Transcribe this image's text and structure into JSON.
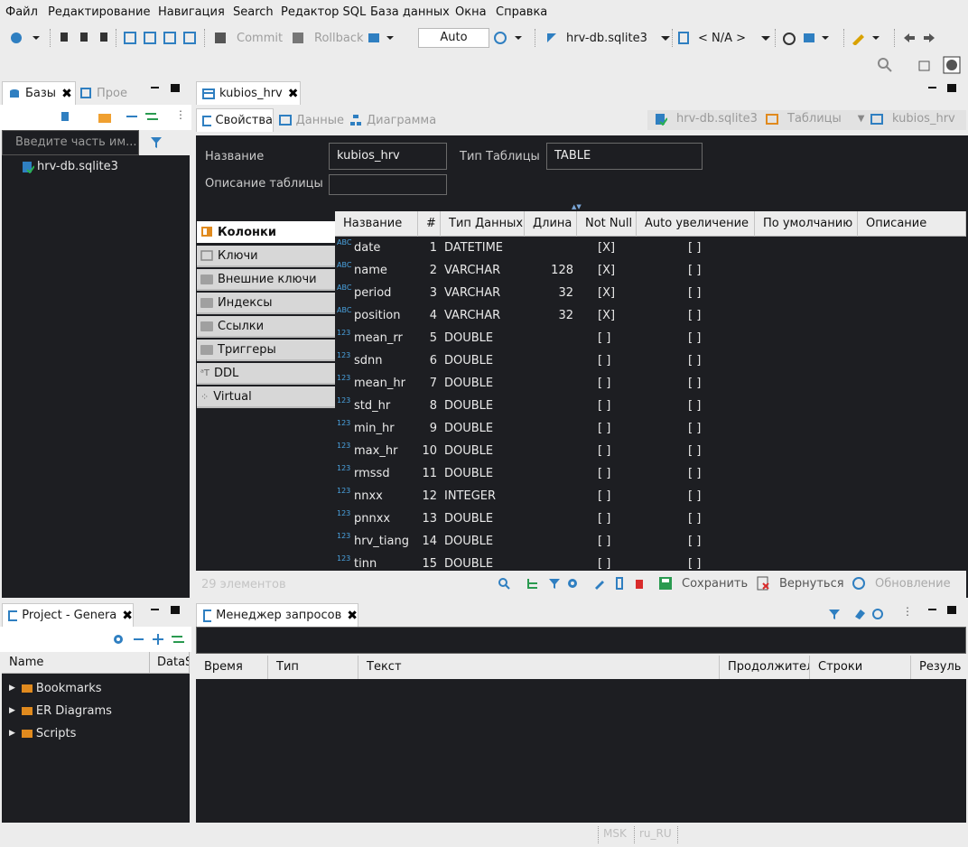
{
  "menu": [
    "Файл",
    "Редактирование",
    "Навигация",
    "Search",
    "Редактор SQL",
    "База данных",
    "Окна",
    "Справка"
  ],
  "toolbar": {
    "commit_label": "Commit",
    "rollback_label": "Rollback",
    "tx_mode": "Auto",
    "datasource": "hrv-db.sqlite3",
    "schema": "< N/A >"
  },
  "db_navigator": {
    "tab_label": "Базы",
    "second_tab_label": "Прое",
    "filter_placeholder": "Введите часть им...",
    "tree": [
      "hrv-db.sqlite3"
    ]
  },
  "editor": {
    "tab_label": "kubios_hrv",
    "subtabs": [
      "Свойства",
      "Данные",
      "Диаграмма"
    ],
    "breadcrumb": [
      "hrv-db.sqlite3",
      "Таблицы",
      "kubios_hrv"
    ],
    "name_label": "Название",
    "name_value": "kubios_hrv",
    "type_label": "Тип Таблицы",
    "type_value": "TABLE",
    "desc_label": "Описание таблицы",
    "side_tabs": [
      "Колонки",
      "Ключи",
      "Внешние ключи",
      "Индексы",
      "Ссылки",
      "Триггеры",
      "DDL",
      "Virtual"
    ],
    "columns_header": [
      "Название",
      "#",
      "Тип Данных",
      "Длина",
      "Not Null",
      "Auto увеличение",
      "По умолчанию",
      "Описание"
    ],
    "columns": [
      {
        "icon": "ABC",
        "name": "date",
        "num": "1",
        "type": "DATETIME",
        "len": "",
        "notnull": "[X]",
        "auto": "[ ]"
      },
      {
        "icon": "ABC",
        "name": "name",
        "num": "2",
        "type": "VARCHAR",
        "len": "128",
        "notnull": "[X]",
        "auto": "[ ]"
      },
      {
        "icon": "ABC",
        "name": "period",
        "num": "3",
        "type": "VARCHAR",
        "len": "32",
        "notnull": "[X]",
        "auto": "[ ]"
      },
      {
        "icon": "ABC",
        "name": "position",
        "num": "4",
        "type": "VARCHAR",
        "len": "32",
        "notnull": "[X]",
        "auto": "[ ]"
      },
      {
        "icon": "123",
        "name": "mean_rr",
        "num": "5",
        "type": "DOUBLE",
        "len": "",
        "notnull": "[ ]",
        "auto": "[ ]"
      },
      {
        "icon": "123",
        "name": "sdnn",
        "num": "6",
        "type": "DOUBLE",
        "len": "",
        "notnull": "[ ]",
        "auto": "[ ]"
      },
      {
        "icon": "123",
        "name": "mean_hr",
        "num": "7",
        "type": "DOUBLE",
        "len": "",
        "notnull": "[ ]",
        "auto": "[ ]"
      },
      {
        "icon": "123",
        "name": "std_hr",
        "num": "8",
        "type": "DOUBLE",
        "len": "",
        "notnull": "[ ]",
        "auto": "[ ]"
      },
      {
        "icon": "123",
        "name": "min_hr",
        "num": "9",
        "type": "DOUBLE",
        "len": "",
        "notnull": "[ ]",
        "auto": "[ ]"
      },
      {
        "icon": "123",
        "name": "max_hr",
        "num": "10",
        "type": "DOUBLE",
        "len": "",
        "notnull": "[ ]",
        "auto": "[ ]"
      },
      {
        "icon": "123",
        "name": "rmssd",
        "num": "11",
        "type": "DOUBLE",
        "len": "",
        "notnull": "[ ]",
        "auto": "[ ]"
      },
      {
        "icon": "123",
        "name": "nnxx",
        "num": "12",
        "type": "INTEGER",
        "len": "",
        "notnull": "[ ]",
        "auto": "[ ]"
      },
      {
        "icon": "123",
        "name": "pnnxx",
        "num": "13",
        "type": "DOUBLE",
        "len": "",
        "notnull": "[ ]",
        "auto": "[ ]"
      },
      {
        "icon": "123",
        "name": "hrv_tiang",
        "num": "14",
        "type": "DOUBLE",
        "len": "",
        "notnull": "[ ]",
        "auto": "[ ]"
      },
      {
        "icon": "123",
        "name": "tinn",
        "num": "15",
        "type": "DOUBLE",
        "len": "",
        "notnull": "[ ]",
        "auto": "[ ]"
      }
    ],
    "element_count": "29 элементов",
    "save_label": "Сохранить",
    "revert_label": "Вернуться",
    "refresh_label": "Обновление"
  },
  "project": {
    "tab_label": "Project - Genera",
    "headers": [
      "Name",
      "DataSo"
    ],
    "items": [
      "Bookmarks",
      "ER Diagrams",
      "Scripts"
    ]
  },
  "query_manager": {
    "tab_label": "Менеджер запросов",
    "headers": [
      "Время",
      "Тип",
      "Текст",
      "Продолжител",
      "Строки",
      "Резуль"
    ]
  },
  "status": {
    "locale": "MSK",
    "lang": "ru_RU"
  }
}
